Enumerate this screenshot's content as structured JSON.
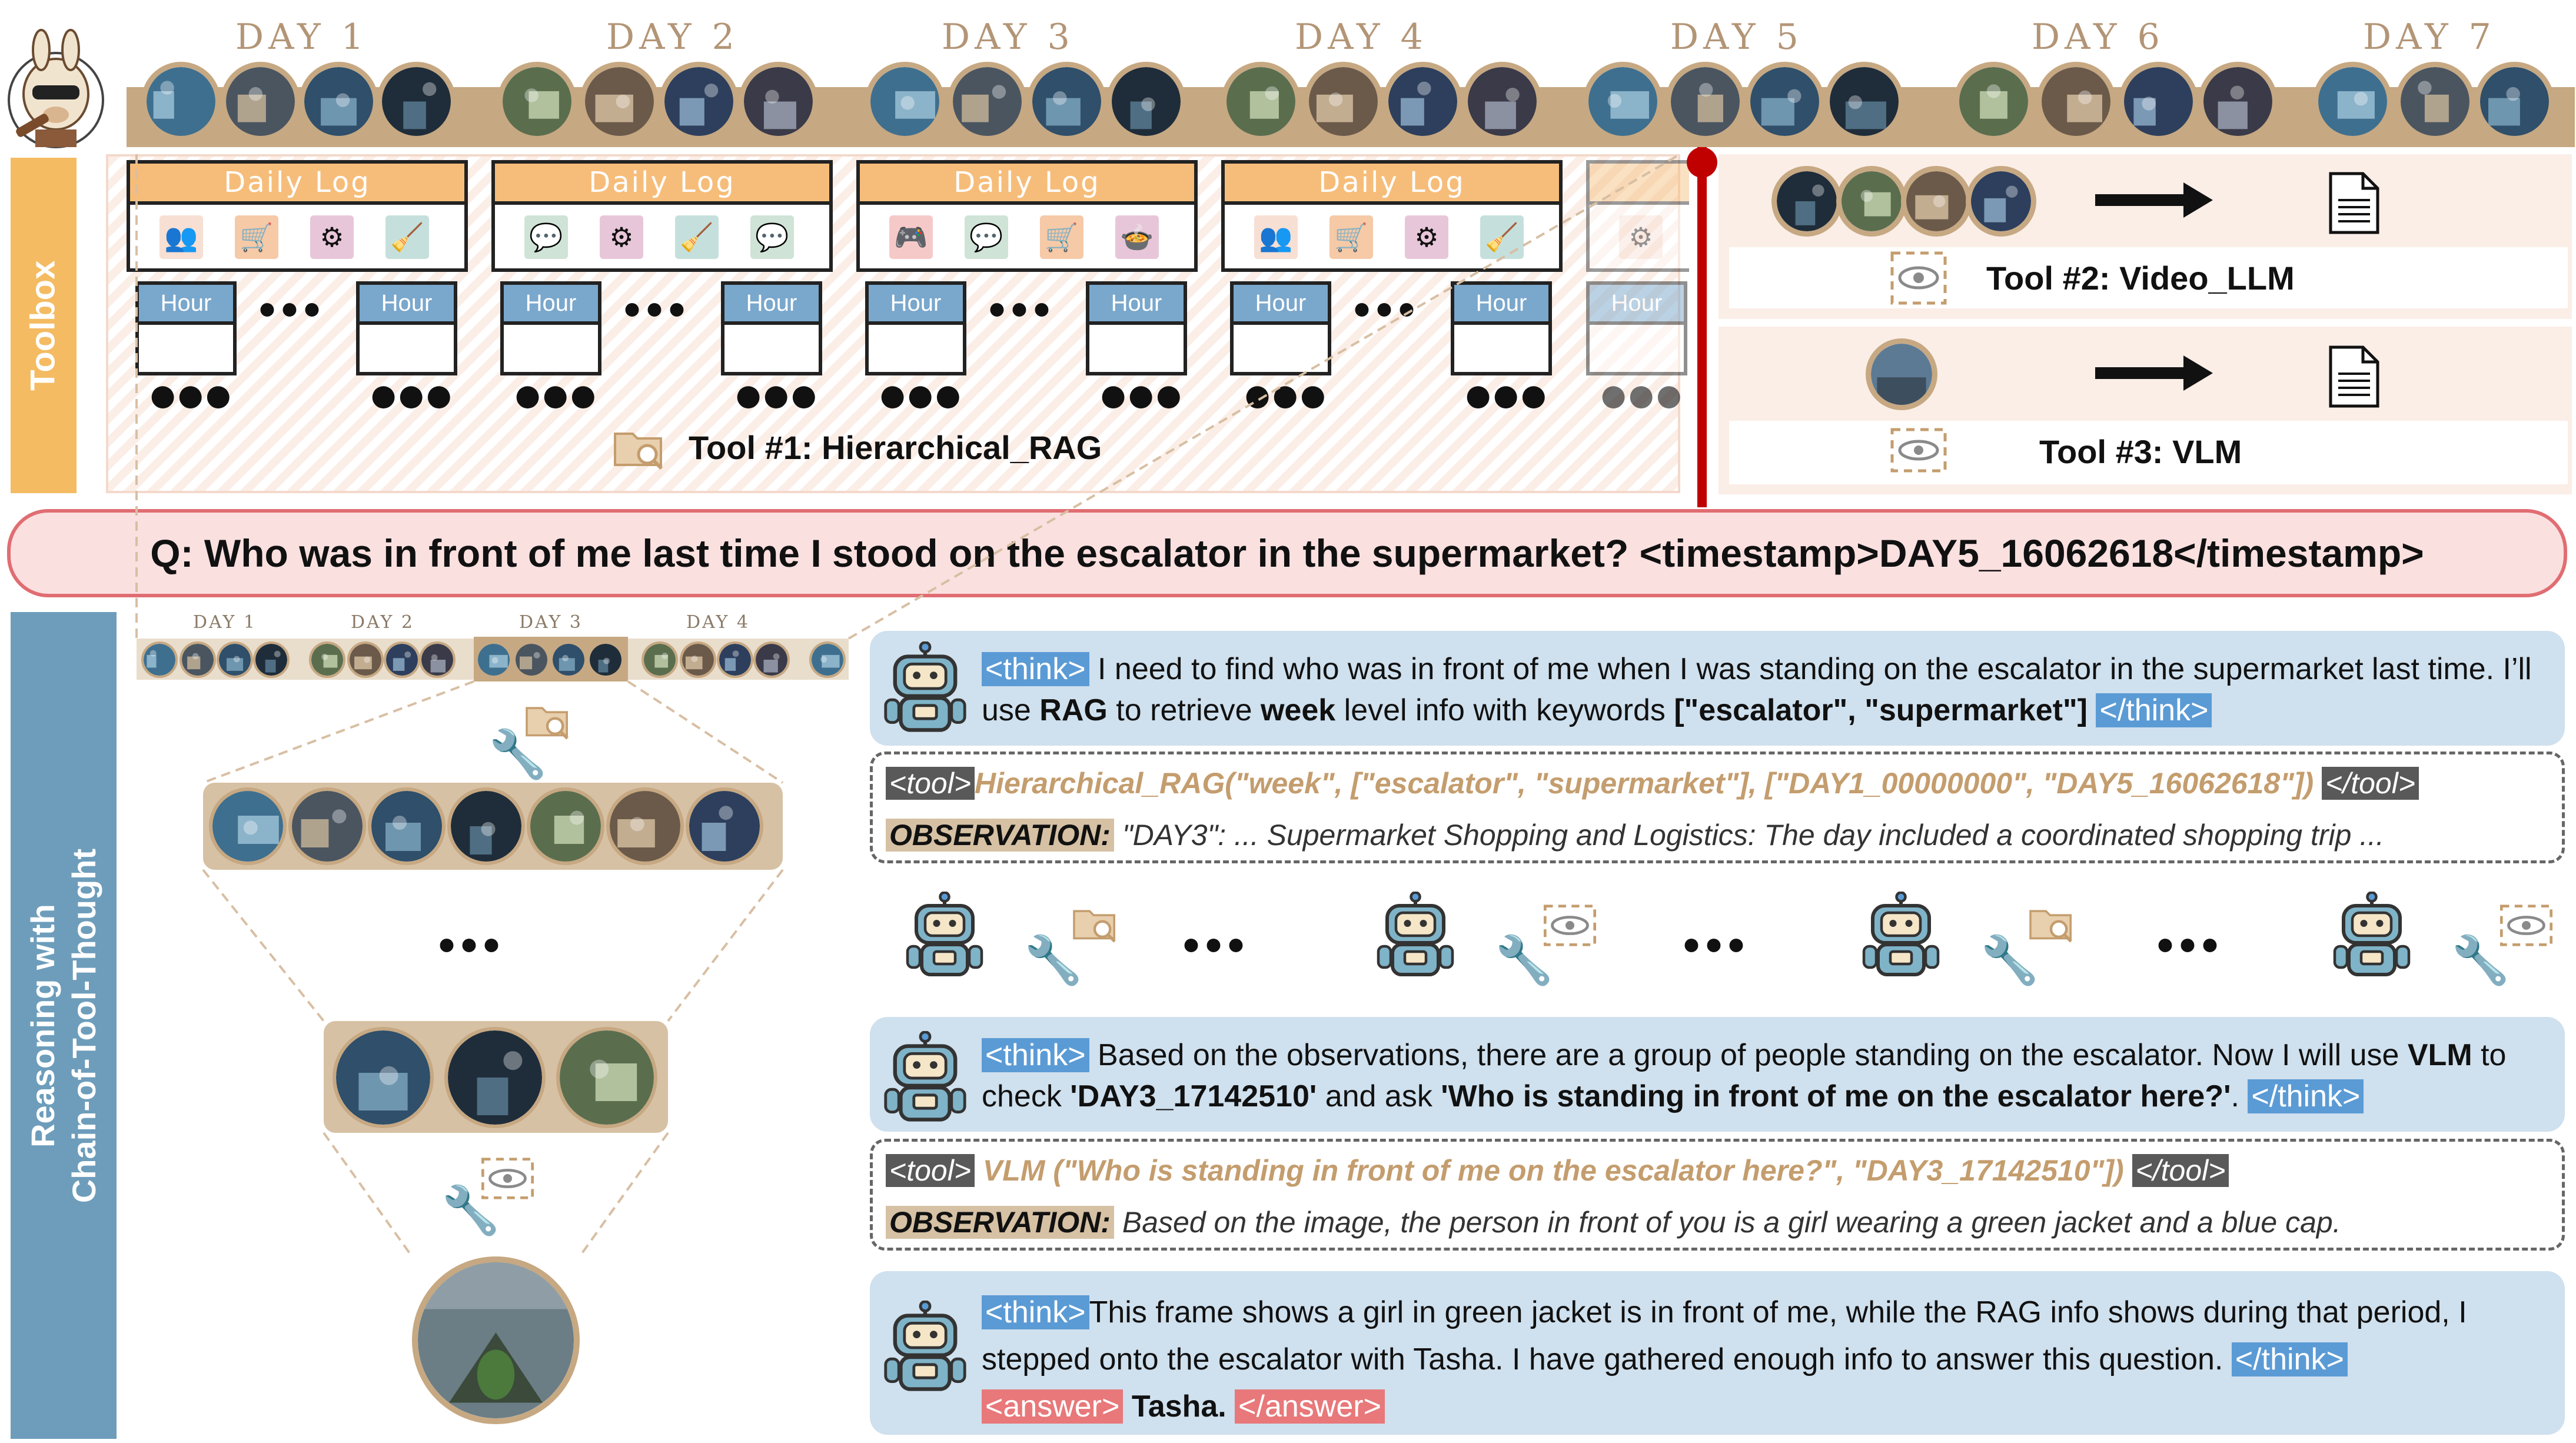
{
  "timeline": {
    "days": [
      "DAY 1",
      "DAY 2",
      "DAY 3",
      "DAY 4",
      "DAY 5",
      "DAY 6",
      "DAY 7"
    ]
  },
  "toolbox": {
    "section_label": "Toolbox",
    "daily_log_label": "Daily Log",
    "hour_label": "Hour",
    "tool1": "Tool #1: Hierarchical_RAG",
    "tool2": "Tool #2: Video_LLM",
    "tool3": "Tool #3: VLM"
  },
  "question": "Q: Who was in front of me last time I stood on the escalator in the supermarket? <timestamp>DAY5_16062618</timestamp>",
  "reasoning": {
    "section_label_line1": "Reasoning with",
    "section_label_line2": "Chain-of-Tool-Thought",
    "mini_days": [
      "DAY 1",
      "DAY 2",
      "DAY 3",
      "DAY 4"
    ],
    "think_open": "<think>",
    "think_close": "</think>",
    "tool_open": "<tool>",
    "tool_close": "</tool>",
    "observation_label": "OBSERVATION:",
    "answer_open": "<answer>",
    "answer_close": "</answer>",
    "step1": {
      "t1": " I need to find who was in front of me when I was standing on the escalator in the supermarket last time. I’ll use ",
      "b1": "RAG",
      "t2": " to retrieve ",
      "b2": "week",
      "t3": " level info with keywords ",
      "b3": "[\"escalator\", \"supermarket\"]"
    },
    "call1": "Hierarchical_RAG(\"week\", [\"escalator\", \"supermarket\"], [\"DAY1_00000000\", \"DAY5_16062618\"])",
    "obs1": "\"DAY3\": ... Supermarket Shopping and Logistics: The day included a coordinated shopping trip ...",
    "step2": {
      "t1": " Based on the observations, there are a group of people standing on the escalator. Now I will use ",
      "b1": "VLM",
      "t2": " to check ",
      "b2": "'DAY3_17142510'",
      "t3": " and ask ",
      "b3": "'Who is standing in front of me on the escalator here?'",
      "t4": ". "
    },
    "call2": "VLM (\"Who is standing in front of me on the escalator here?\", \"DAY3_17142510\"])",
    "obs2": "Based on the image, the person in front of you is a girl wearing a green jacket and a blue cap.",
    "step3": {
      "t1": "This frame shows a girl in green jacket is in front of me, while the RAG info shows during that period, I stepped onto the escalator with Tasha. I have gathered enough info to answer this question. ",
      "answer": "Tasha."
    }
  },
  "colors": {
    "timeline_band": "#c6a882",
    "toolbox_label_bg": "#f4bb62",
    "reasoning_label_bg": "#6d9dbb",
    "question_border": "#e06d72",
    "question_bg": "#fbe0e0",
    "think_panel": "#cfe0ee",
    "divider": "#c00000"
  },
  "icons": [
    "avatar-llama-icon",
    "meeting-icon",
    "shopping-cart-icon",
    "gear-tool-icon",
    "broom-icon",
    "chat-icon",
    "game-controller-icon",
    "cooking-pot-icon",
    "folder-search-icon",
    "wrench-icon",
    "eye-scan-icon",
    "robot-icon",
    "document-icon",
    "arrow-right-icon"
  ]
}
